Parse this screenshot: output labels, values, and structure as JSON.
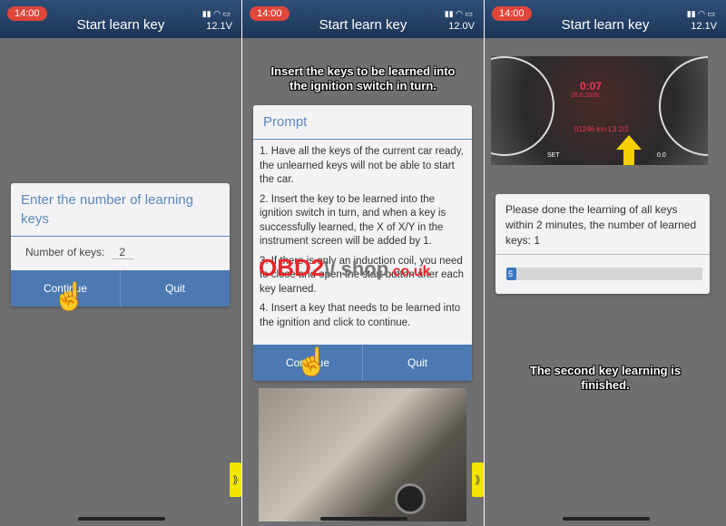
{
  "status": {
    "time": "14:00",
    "title": "Start learn key",
    "signal_icons": "signal-wifi-battery"
  },
  "panel1": {
    "volt": "12.1V",
    "dialog_title": "Enter the number of learning keys",
    "field_label": "Number of keys:",
    "field_value": "2",
    "continue": "Continue",
    "quit": "Quit"
  },
  "panel2": {
    "volt": "12.0V",
    "caption": "Insert the keys to be learned into the ignition switch in turn.",
    "dialog_title": "Prompt",
    "steps": [
      "1. Have all the keys of the current car ready, the unlearned keys will not be able to start the car.",
      "2. Insert the key to be learned into the ignition switch in turn, and when a key is successfully learned, the X of X/Y in the instrument screen will be added by 1.",
      "3. If there is only an induction coil, you need to close and open the start button after each key learned.",
      "4. Insert a key that needs to be learned into the ignition and click to continue."
    ],
    "continue": "Continue",
    "quit": "Quit"
  },
  "panel3": {
    "volt": "12.1V",
    "dash": {
      "time": "0:07",
      "date": "26.6.2009",
      "line": "01246 km L3 2/2",
      "set": "SET",
      "reset": "0.0"
    },
    "message": "Please done the learning of all keys within 2 minutes, the number of learned keys: 1",
    "progress_label": "5",
    "progress_percent": 5,
    "caption": "The second key learning is finished."
  },
  "watermark": "OBD2 shop.co.uk",
  "colors": {
    "header": "#1d3557",
    "accent": "#4c79b2",
    "time_pill": "#e0463a",
    "handle": "#f2e500"
  }
}
